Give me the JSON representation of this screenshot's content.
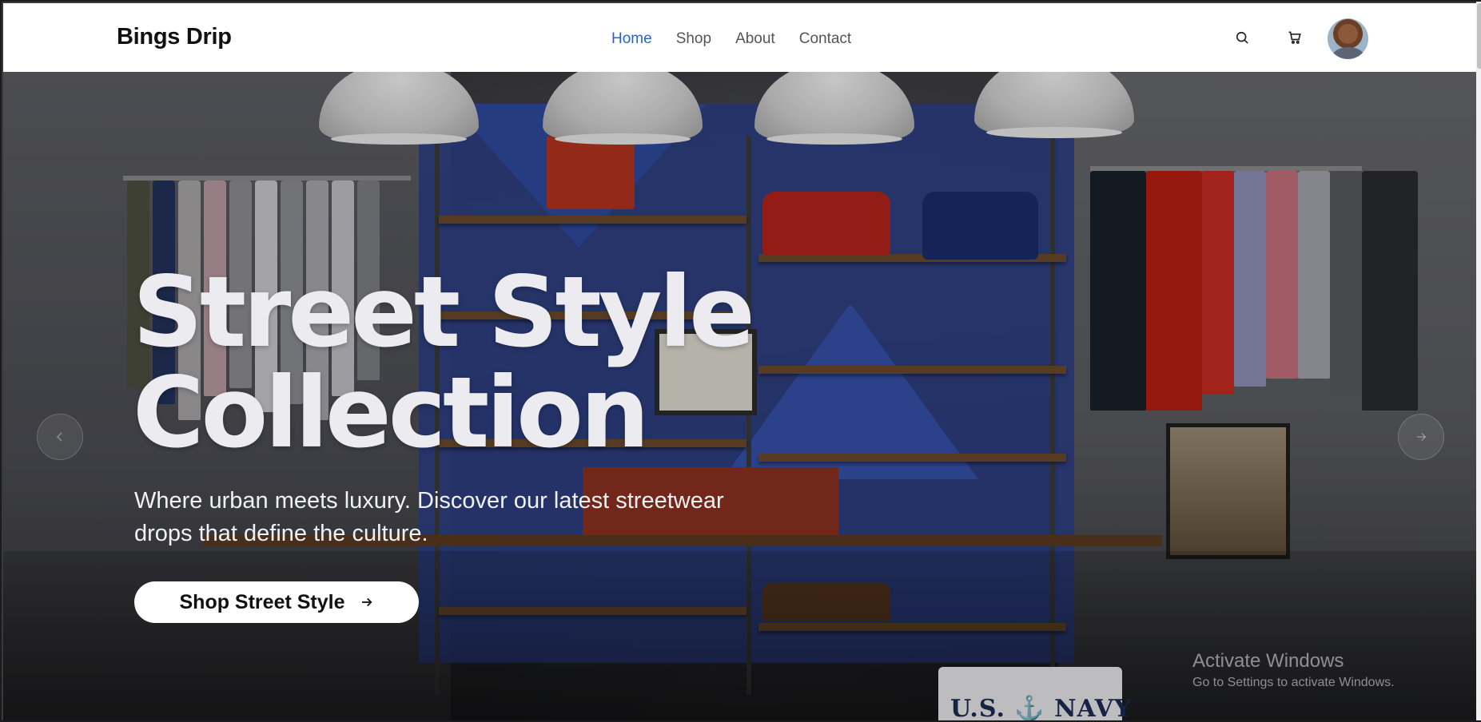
{
  "navbar": {
    "brand": "Bings Drip",
    "links": [
      {
        "label": "Home",
        "active": true
      },
      {
        "label": "Shop",
        "active": false
      },
      {
        "label": "About",
        "active": false
      },
      {
        "label": "Contact",
        "active": false
      }
    ],
    "icons": [
      "search-icon",
      "cart-icon"
    ],
    "accent_color": "#2a63c7"
  },
  "hero": {
    "title_line1": "Street Style",
    "title_line2": "Collection",
    "subtitle_line1": "Where urban meets luxury. Discover our latest streetwear",
    "subtitle_line2": "drops that define the culture.",
    "cta_label": "Shop Street Style",
    "cta_icon": "arrow-right-icon",
    "prev_icon": "chevron-left-icon",
    "next_icon": "chevron-right-icon",
    "shirt_text": "U.S. ⚓ NAVY"
  },
  "watermark": {
    "title": "Activate Windows",
    "subtitle": "Go to Settings to activate Windows."
  }
}
